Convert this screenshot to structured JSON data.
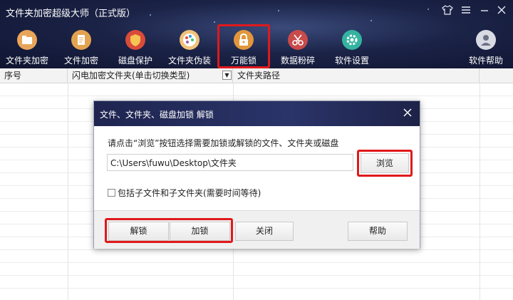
{
  "window": {
    "title": "文件夹加密超级大师（正式版）"
  },
  "toolbar": {
    "items": [
      {
        "label": "文件夹加密",
        "icon": "folder-icon",
        "color": "#e8a55a"
      },
      {
        "label": "文件加密",
        "icon": "document-icon",
        "color": "#e3a24f"
      },
      {
        "label": "磁盘保护",
        "icon": "shield-icon",
        "color": "#d94b3a"
      },
      {
        "label": "文件夹伪装",
        "icon": "palette-icon",
        "color": "#f0c27a"
      },
      {
        "label": "万能锁",
        "icon": "padlock-icon",
        "color": "#e2973a"
      },
      {
        "label": "数据粉碎",
        "icon": "scissors-icon",
        "color": "#c94a4a"
      },
      {
        "label": "软件设置",
        "icon": "gear-icon",
        "color": "#34b3a0"
      },
      {
        "label": "软件帮助",
        "icon": "user-icon",
        "color": "#d9dbe4"
      }
    ]
  },
  "table": {
    "columns": [
      "序号",
      "闪电加密文件夹(单击切换类型)",
      "文件夹路径"
    ]
  },
  "dialog": {
    "title": "文件、文件夹、磁盘加锁 解锁",
    "hint": "请点击“浏览”按钮选择需要加锁或解锁的文件、文件夹或磁盘",
    "path_value": "C:\\Users\\fuwu\\Desktop\\文件夹",
    "browse_label": "浏览",
    "checkbox_label": "包括子文件和子文件夹(需要时间等待)",
    "unlock_label": "解锁",
    "lock_label": "加锁",
    "close_label": "关闭",
    "help_label": "帮助"
  },
  "colors": {
    "highlight": "#e0191b",
    "header_bg": "#1b2347"
  }
}
